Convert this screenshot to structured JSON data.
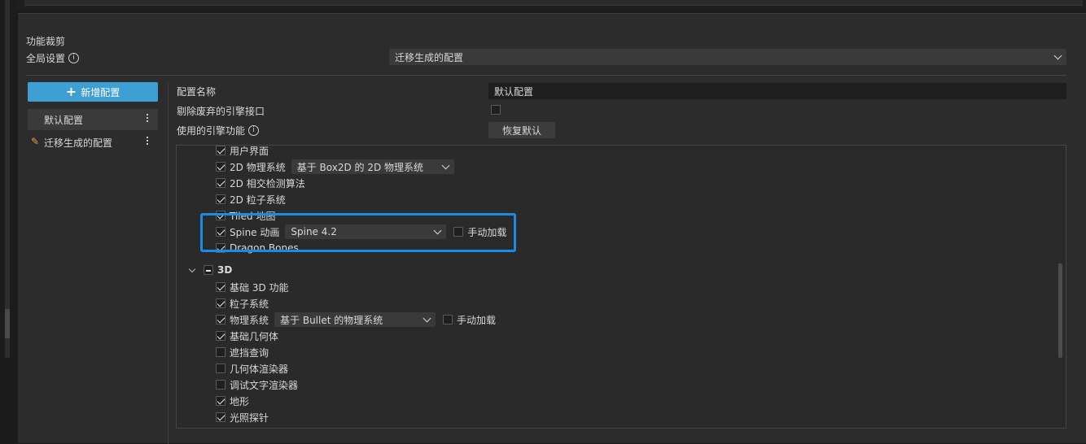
{
  "section_title": "功能裁剪",
  "global_settings": {
    "label": "全局设置",
    "selected": "迁移生成的配置"
  },
  "add_button_label": "新增配置",
  "configs": [
    {
      "label": "默认配置"
    },
    {
      "label": "迁移生成的配置"
    }
  ],
  "form": {
    "name_label": "配置名称",
    "name_value": "默认配置",
    "deprecated_label": "剔除废弃的引擎接口",
    "features_label": "使用的引擎功能",
    "restore_label": "恢复默认"
  },
  "tree": {
    "items_2d": [
      {
        "label": "用户界面",
        "checked": true
      },
      {
        "label": "2D 物理系统",
        "checked": true,
        "select": "基于 Box2D 的 2D 物理系统"
      },
      {
        "label": "2D 相交检测算法",
        "checked": true
      },
      {
        "label": "2D 粒子系统",
        "checked": true
      },
      {
        "label": "Tiled 地图",
        "checked": true
      },
      {
        "label": "Spine 动画",
        "checked": true,
        "select": "Spine 4.2",
        "manual_label": "手动加载"
      },
      {
        "label": "Dragon Bones",
        "checked": true
      }
    ],
    "group_3d": {
      "label": "3D"
    },
    "items_3d": [
      {
        "label": "基础 3D 功能",
        "checked": true
      },
      {
        "label": "粒子系统",
        "checked": true
      },
      {
        "label": "物理系统",
        "checked": true,
        "select": "基于 Bullet 的物理系统",
        "manual_label": "手动加载"
      },
      {
        "label": "基础几何体",
        "checked": true
      },
      {
        "label": "遮挡查询",
        "checked": false
      },
      {
        "label": "几何体渲染器",
        "checked": false
      },
      {
        "label": "调试文字渲染器",
        "checked": false
      },
      {
        "label": "地形",
        "checked": true
      },
      {
        "label": "光照探针",
        "checked": true
      }
    ]
  },
  "colors": {
    "accent": "#3e9fd3",
    "highlight": "#1a8ce8"
  }
}
